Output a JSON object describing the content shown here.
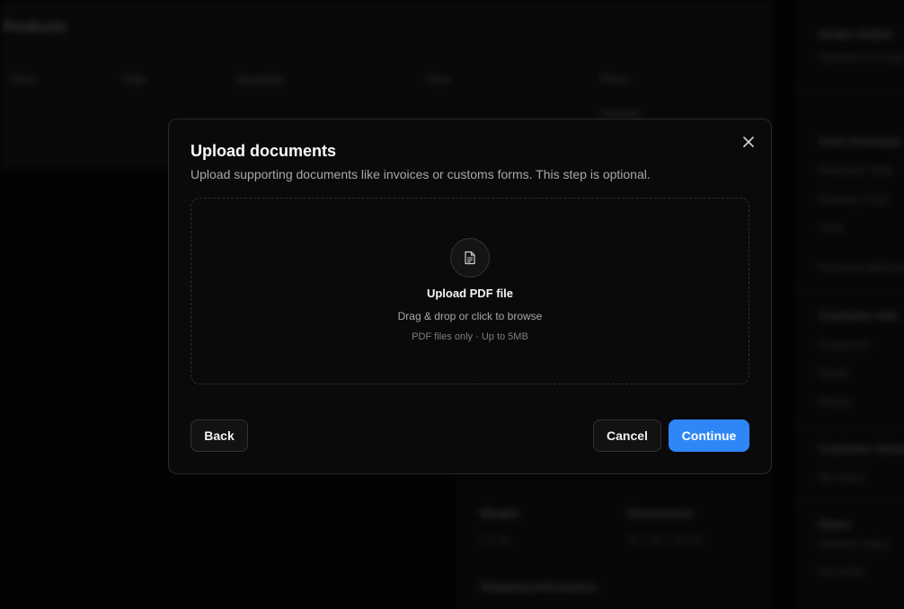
{
  "background": {
    "products_title": "Products",
    "columns": [
      "SKU",
      "Title",
      "Quantity",
      "Size",
      "Price"
    ],
    "right_panel": {
      "order_title": "Order #1024",
      "order_sub": "Updated 2m ago",
      "cost_summary": "Cost Summary",
      "product_total": "Products Total",
      "delivery_cost": "Delivery Cost",
      "total": "Total",
      "payment_method": "Payment Method",
      "customer_info": "Customer Info",
      "customer": "Customer",
      "email": "Email",
      "phone": "Phone",
      "customer_notes": "Customer Notes",
      "no_notes": "No notes",
      "notes": "Notes",
      "internal_notes": "Internal notes",
      "no_notes_2": "No notes"
    },
    "bottom_panel": {
      "weight_label": "Weight",
      "weight_value": "1.2 kg",
      "dimensions_label": "Dimensions",
      "dimensions_value": "30 x 20 x 10 cm",
      "shipping_info": "Shipping Information"
    }
  },
  "modal": {
    "title": "Upload documents",
    "description": "Upload supporting documents like invoices or customs forms. This step is optional.",
    "close_icon": "close-icon",
    "dropzone": {
      "icon": "document-icon",
      "title": "Upload PDF file",
      "subtitle": "Drag & drop or click to browse",
      "hint": "PDF files only · Up to 5MB"
    },
    "buttons": {
      "back": "Back",
      "cancel": "Cancel",
      "continue": "Continue"
    },
    "colors": {
      "primary": "#2f86f6",
      "surface": "#0a0a0a",
      "border": "#2a2a2a"
    }
  }
}
